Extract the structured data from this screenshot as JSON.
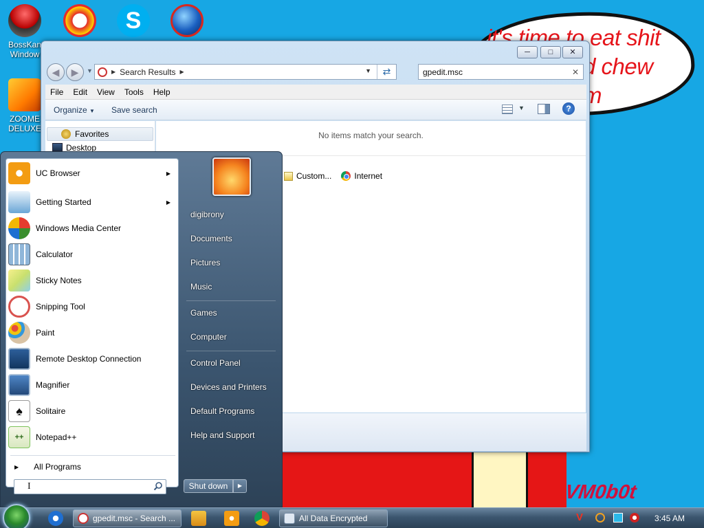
{
  "desktop": {
    "icons": [
      {
        "label": "BossKan",
        "label2": "Window",
        "icon": "bosskan-icon"
      },
      {
        "label": "",
        "icon": "p-app-icon"
      },
      {
        "label": "",
        "icon": "skype-icon"
      },
      {
        "label": "",
        "icon": "globe-icon"
      },
      {
        "label": "ZOOME",
        "label2": "DELUXE",
        "icon": "zoome-icon"
      }
    ],
    "bubble_text": "it's time to eat shit d chew m",
    "bubble_line1": "it's time to eat shit",
    "bubble_line2": "d chew",
    "bubble_line3": "m",
    "signature": "VM0b0t"
  },
  "explorer": {
    "address": {
      "crumb": "Search Results"
    },
    "search_value": "gpedit.msc",
    "menu": [
      "File",
      "Edit",
      "View",
      "Tools",
      "Help"
    ],
    "commands": {
      "organize": "Organize",
      "save_search": "Save search"
    },
    "nav": {
      "favorites": "Favorites",
      "desktop": "Desktop"
    },
    "empty_message": "No items match your search.",
    "search_again": [
      {
        "label": "Custom..."
      },
      {
        "label": "Internet"
      }
    ]
  },
  "start_menu": {
    "programs": [
      {
        "label": "UC Browser",
        "has_submenu": true,
        "color": "#f39c12"
      },
      {
        "label": "Getting Started",
        "has_submenu": true,
        "color": "#6aa6d6"
      },
      {
        "label": "Windows Media Center",
        "has_submenu": false,
        "color": "#3a8f2e"
      },
      {
        "label": "Calculator",
        "has_submenu": false,
        "color": "#8fb6d9"
      },
      {
        "label": "Sticky Notes",
        "has_submenu": false,
        "color": "#e9e27a"
      },
      {
        "label": "Snipping Tool",
        "has_submenu": false,
        "color": "#d9534f"
      },
      {
        "label": "Paint",
        "has_submenu": false,
        "color": "#5aa0d6"
      },
      {
        "label": "Remote Desktop Connection",
        "has_submenu": false,
        "color": "#2d5f9a"
      },
      {
        "label": "Magnifier",
        "has_submenu": false,
        "color": "#4f86c6"
      },
      {
        "label": "Solitaire",
        "has_submenu": false,
        "color": "#e8e8e8"
      },
      {
        "label": "Notepad++",
        "has_submenu": false,
        "color": "#7cc35a"
      }
    ],
    "all_programs": "All Programs",
    "search_placeholder": "",
    "right_items": [
      {
        "label": "digibrony"
      },
      {
        "label": "Documents"
      },
      {
        "label": "Pictures"
      },
      {
        "label": "Music"
      },
      {
        "label": "Games"
      },
      {
        "label": "Computer"
      },
      {
        "label": "Control Panel"
      },
      {
        "label": "Devices and Printers"
      },
      {
        "label": "Default Programs"
      },
      {
        "label": "Help and Support"
      }
    ],
    "shutdown": "Shut down"
  },
  "taskbar": {
    "windows": [
      {
        "label": "gpedit.msc - Search ...",
        "active": true
      },
      {
        "label": "All Data Encrypted",
        "active": false
      }
    ],
    "clock": "3:45 AM"
  },
  "colors": {
    "accent": "#1ea8e2",
    "bubble_text": "#e6151b",
    "signature": "#d2103b"
  }
}
